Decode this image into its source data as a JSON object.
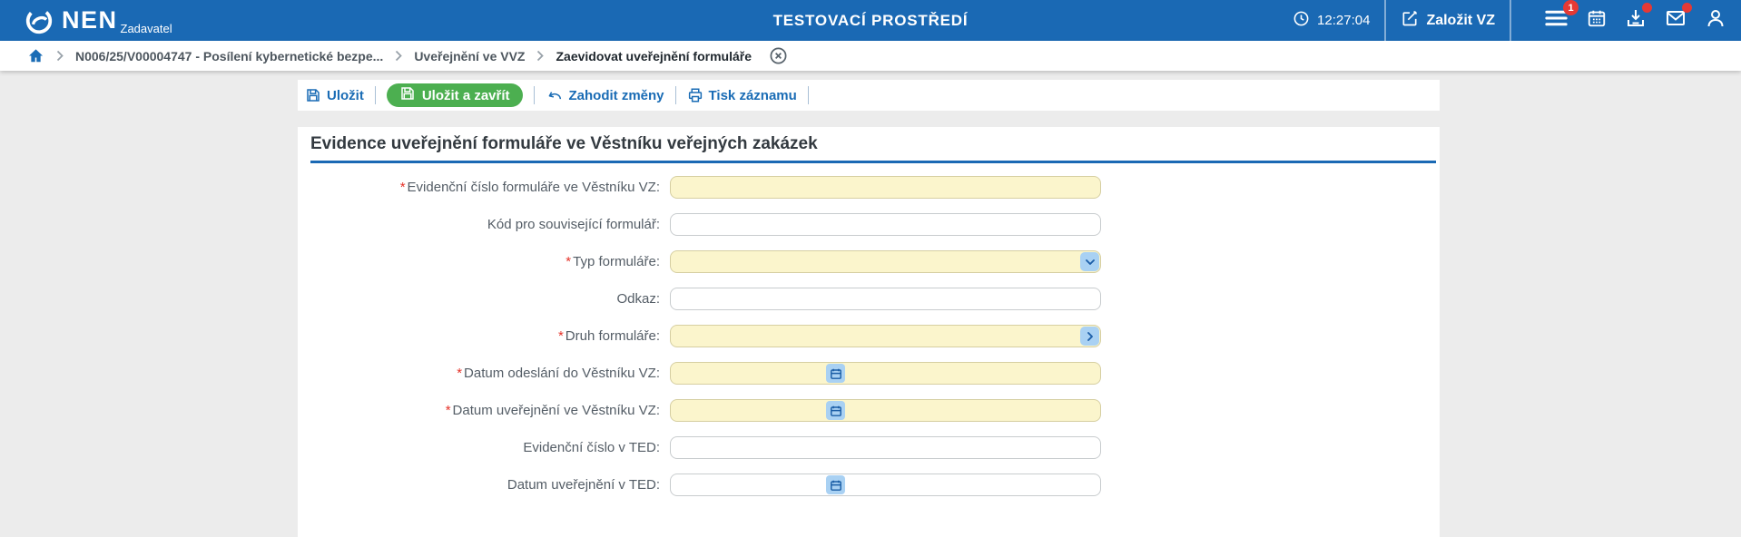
{
  "header": {
    "brand_name": "NEN",
    "brand_role": "Zadavatel",
    "environment_title": "TESTOVACÍ PROSTŘEDÍ",
    "clock": "12:27:04",
    "create_vz_label": "Založit VZ",
    "menu_badge": "1",
    "colors": {
      "bar": "#1a69b4",
      "badge": "#e53935"
    }
  },
  "breadcrumb": {
    "items": [
      {
        "label": "N006/25/V00004747 - Posílení kybernetické bezpe..."
      },
      {
        "label": "Uveřejnění ve VVZ"
      },
      {
        "label": "Zaevidovat uveřejnění formuláře"
      }
    ]
  },
  "toolbar": {
    "save_label": "Uložit",
    "save_close_label": "Uložit a zavřít",
    "discard_label": "Zahodit změny",
    "print_label": "Tisk záznamu",
    "accent": "#1a6cb5",
    "save_close_bg": "#4caf50"
  },
  "form": {
    "title": "Evidence uveřejnění formuláře ve Věstníku veřejných zakázek",
    "required_color": "#e5332a",
    "required_field_bg": "#fbf5cc",
    "fields": [
      {
        "id": "evidencni-cislo-formulare-vvz",
        "label": "Evidenční číslo formuláře ve Věstníku VZ:",
        "required": true,
        "type": "text",
        "highlight": true,
        "value": ""
      },
      {
        "id": "kod-pro-souvisejici-formular",
        "label": "Kód pro související formulář:",
        "required": false,
        "type": "text",
        "highlight": false,
        "value": ""
      },
      {
        "id": "typ-formulare",
        "label": "Typ formuláře:",
        "required": true,
        "type": "select",
        "highlight": true,
        "value": ""
      },
      {
        "id": "odkaz",
        "label": "Odkaz:",
        "required": false,
        "type": "text",
        "highlight": false,
        "value": ""
      },
      {
        "id": "druh-formulare",
        "label": "Druh formuláře:",
        "required": true,
        "type": "picker",
        "highlight": true,
        "value": ""
      },
      {
        "id": "datum-odeslani-vvz",
        "label": "Datum odeslání do Věstníku VZ:",
        "required": true,
        "type": "date",
        "highlight": true,
        "value": ""
      },
      {
        "id": "datum-uverejneni-vvz",
        "label": "Datum uveřejnění ve Věstníku VZ:",
        "required": true,
        "type": "date",
        "highlight": true,
        "value": ""
      },
      {
        "id": "evidencni-cislo-ted",
        "label": "Evidenční číslo v TED:",
        "required": false,
        "type": "text",
        "highlight": false,
        "value": ""
      },
      {
        "id": "datum-uverejneni-ted",
        "label": "Datum uveřejnění v TED:",
        "required": false,
        "type": "date",
        "highlight": false,
        "value": ""
      }
    ]
  }
}
